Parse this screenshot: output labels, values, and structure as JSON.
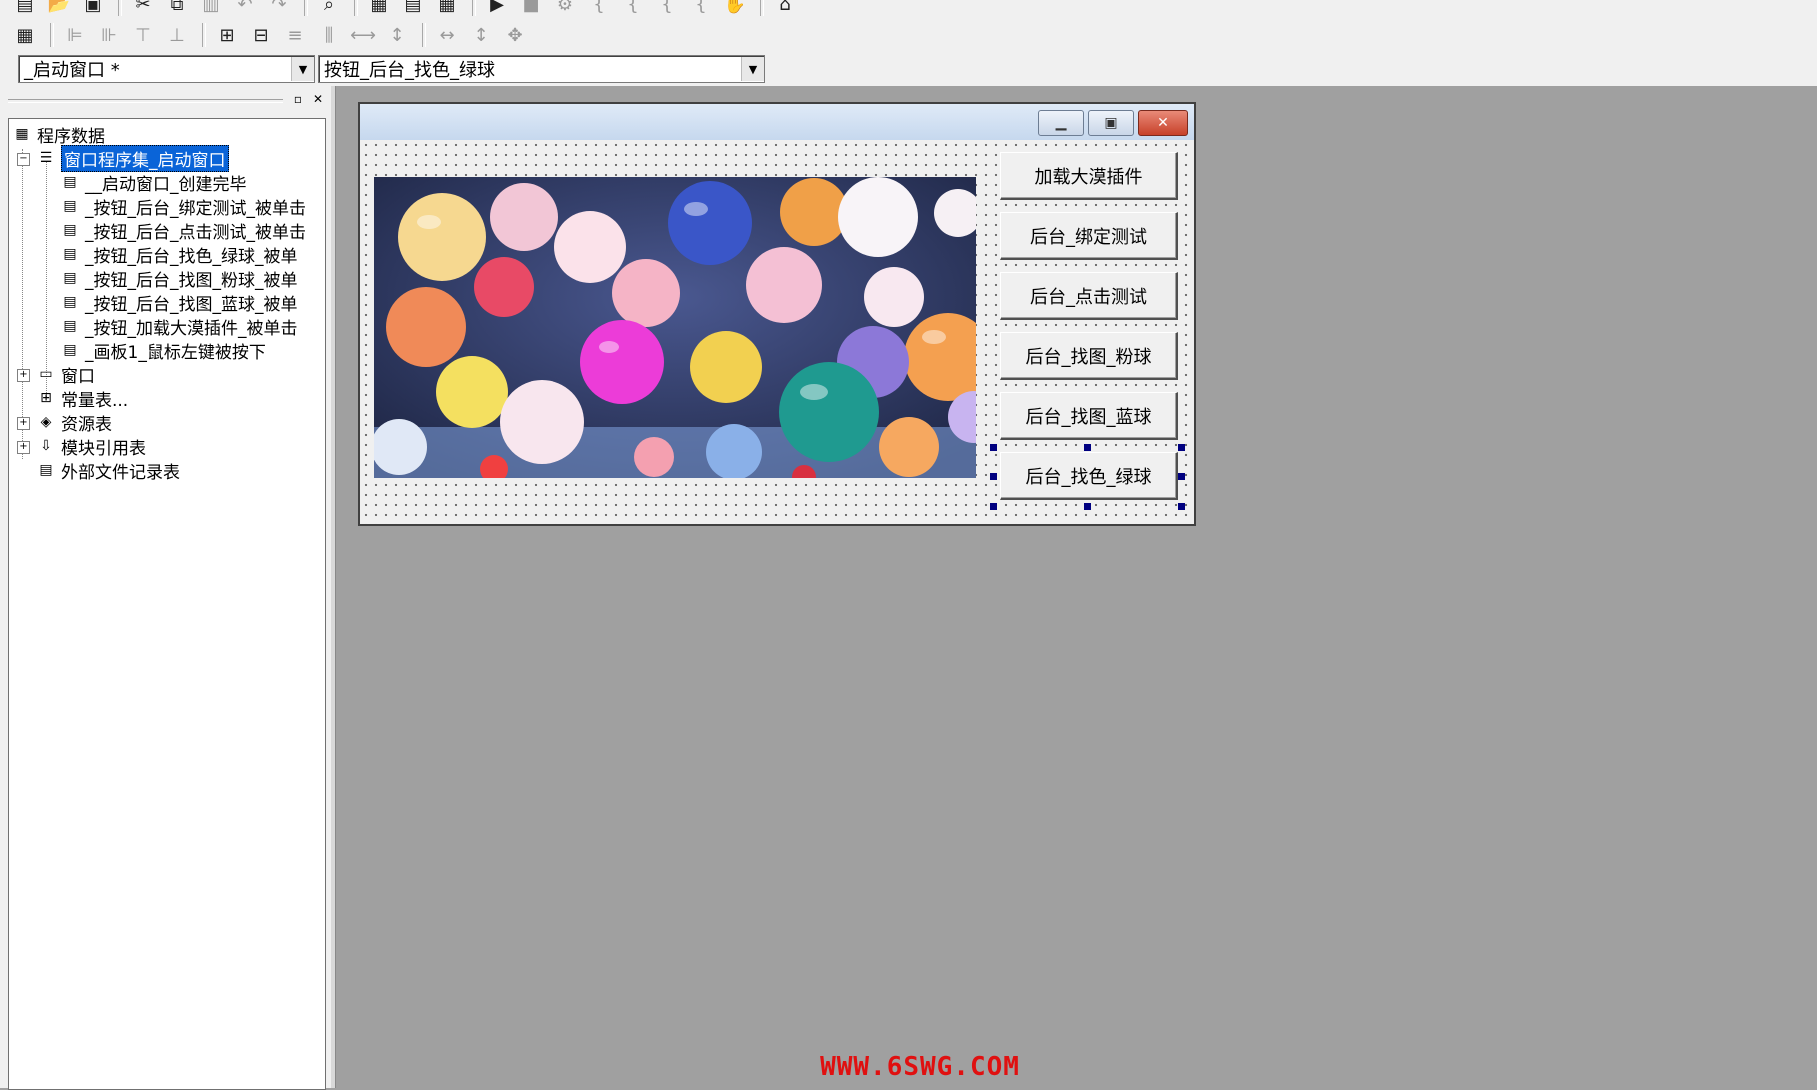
{
  "toolbar": {
    "object_combo": "_启动窗口 *",
    "method_combo": "按钮_后台_找色_绿球"
  },
  "tree": {
    "root": "程序数据",
    "assembly": "窗口程序集_启动窗口",
    "subs": [
      "__启动窗口_创建完毕",
      "_按钮_后台_绑定测试_被单击",
      "_按钮_后台_点击测试_被单击",
      "_按钮_后台_找色_绿球_被单",
      "_按钮_后台_找图_粉球_被单",
      "_按钮_后台_找图_蓝球_被单",
      "_按钮_加载大漠插件_被单击",
      "_画板1_鼠标左键被按下"
    ],
    "window": "窗口",
    "constants": "常量表...",
    "resources": "资源表",
    "modules": "模块引用表",
    "external": "外部文件记录表"
  },
  "form": {
    "buttons": [
      "加载大漠插件",
      "后台_绑定测试",
      "后台_点击测试",
      "后台_找图_粉球",
      "后台_找图_蓝球",
      "后台_找色_绿球"
    ]
  },
  "watermark": "WWW.6SWG.COM"
}
